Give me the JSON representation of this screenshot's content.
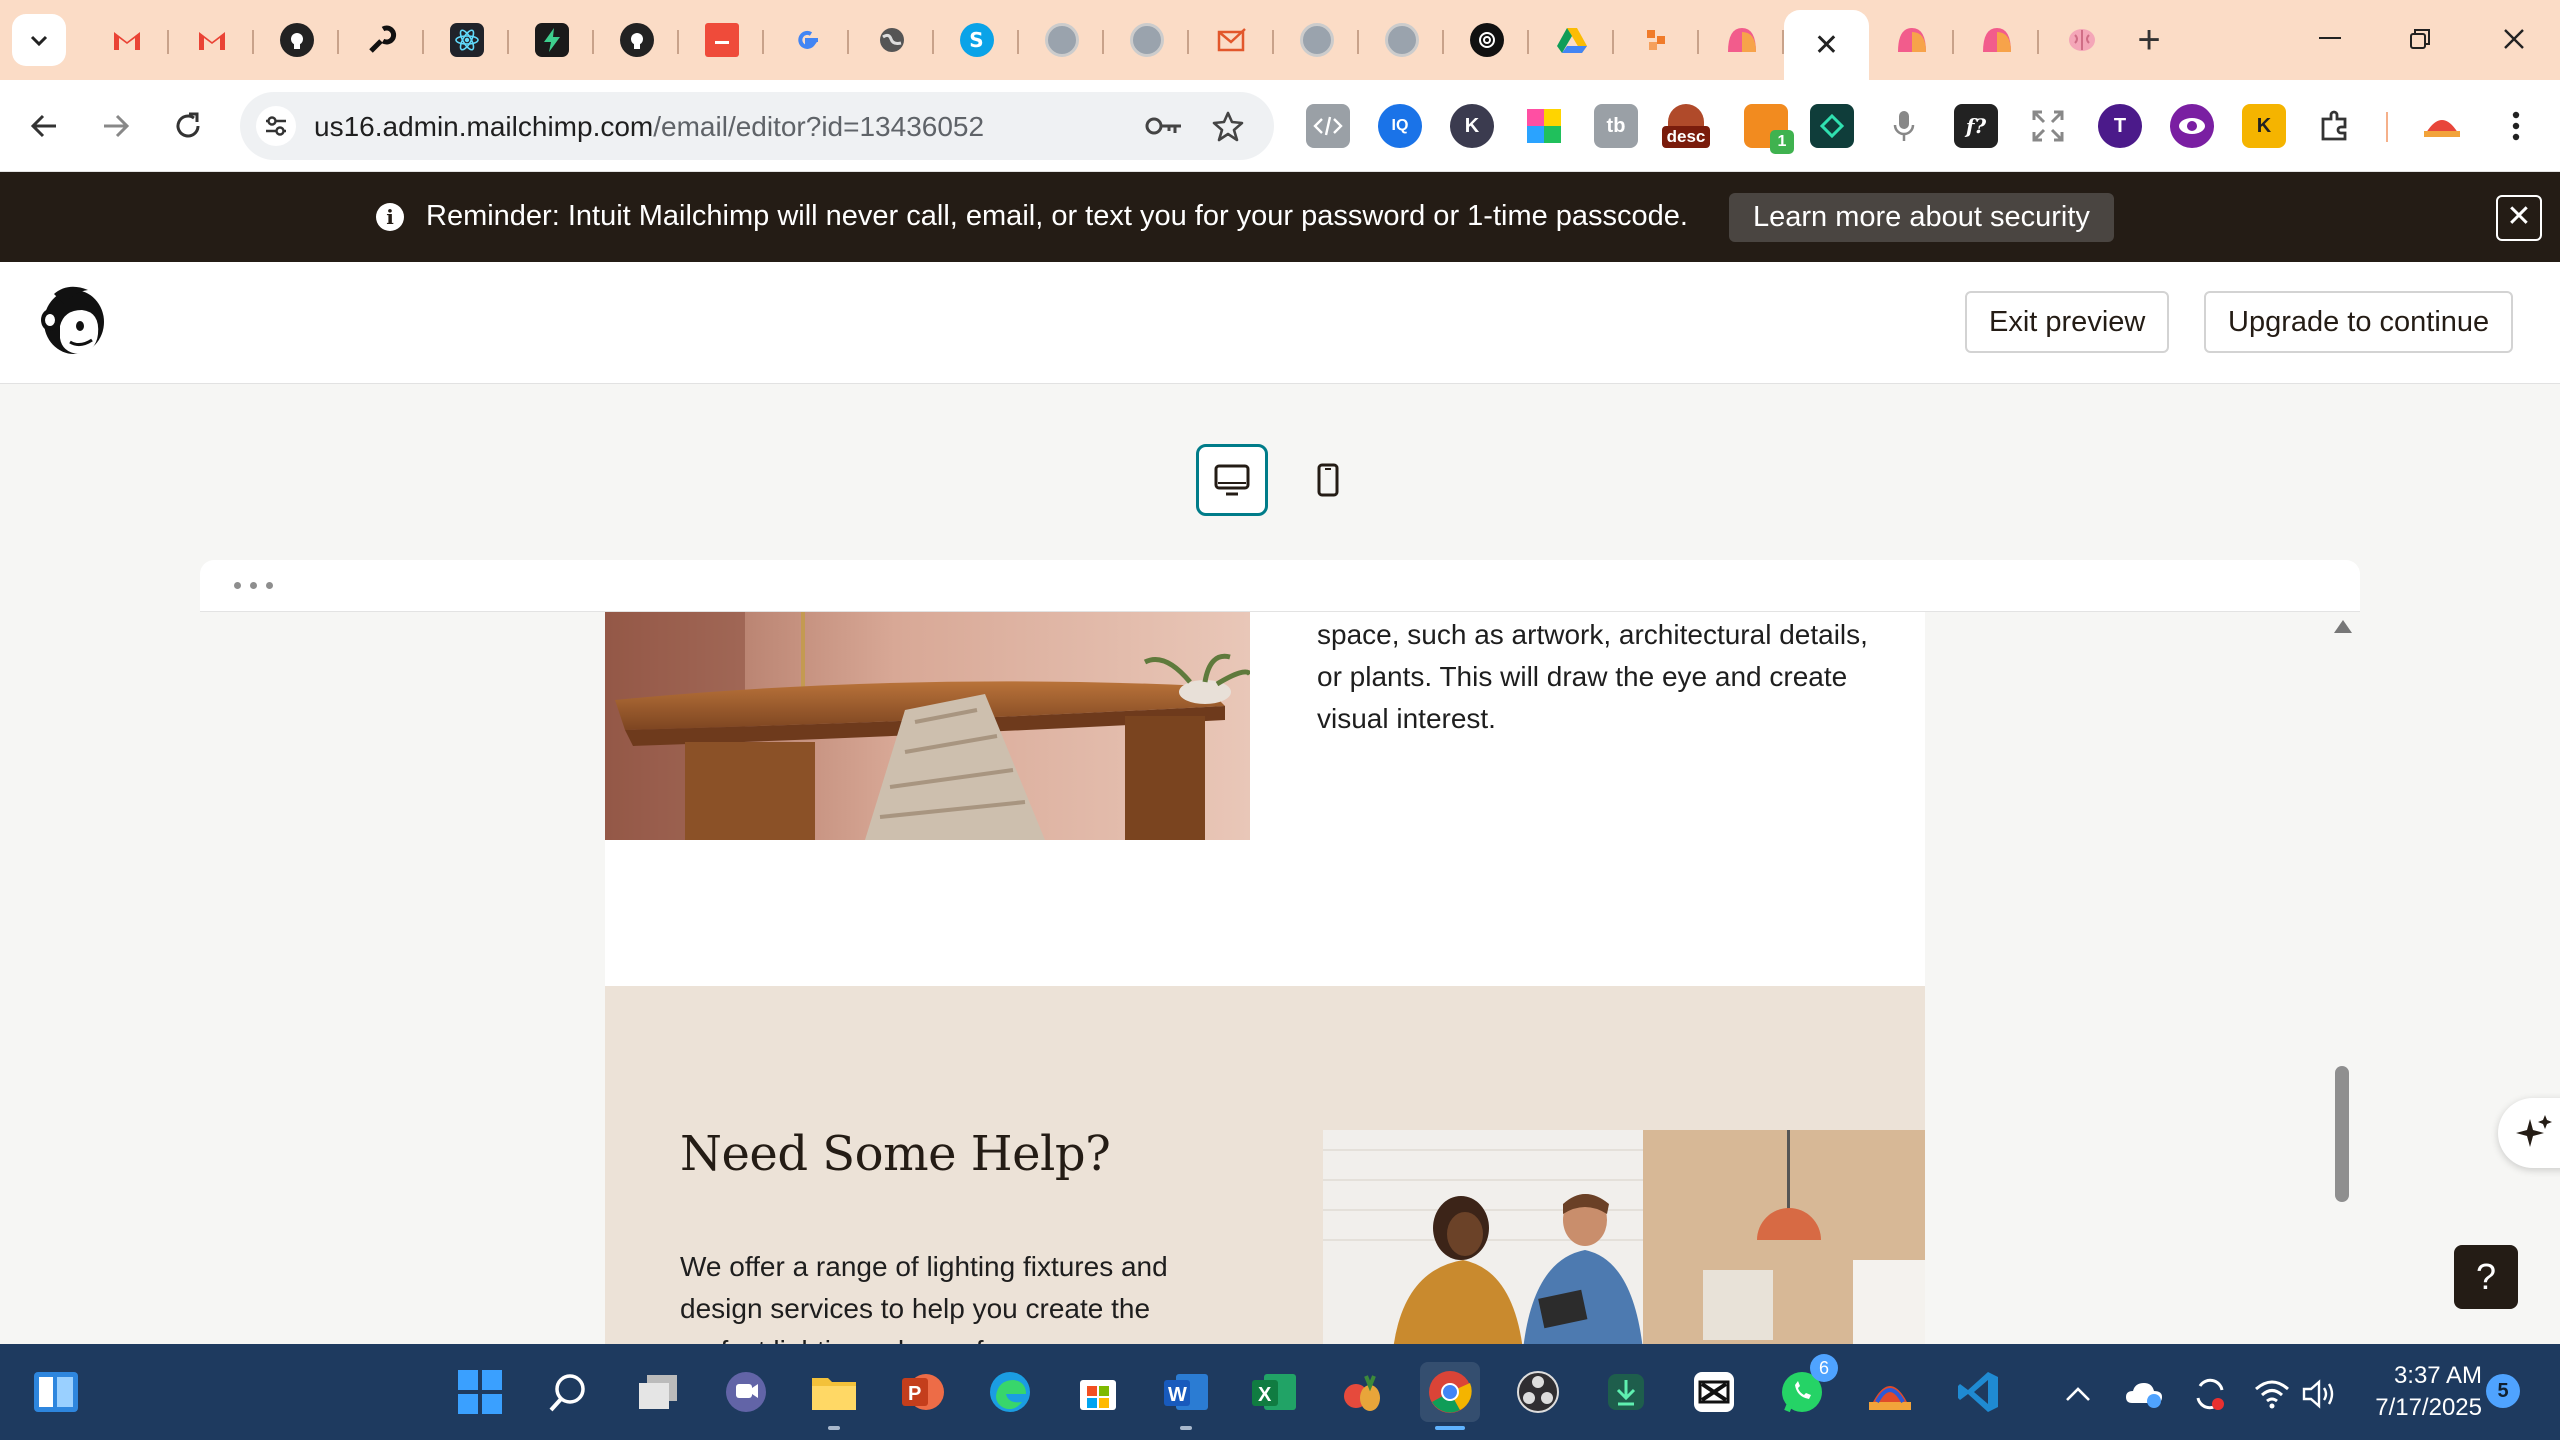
{
  "browser": {
    "url_domain": "us16.admin.mailchimp.com",
    "url_path": "/email/editor?id=13436052",
    "active_tab_close": "✕",
    "new_tab": "+"
  },
  "extensions": {
    "desc_label": "desc",
    "badge_count": "1"
  },
  "banner": {
    "info_glyph": "i",
    "message": "Reminder: Intuit Mailchimp will never call, email, or text you for your password or 1-time passcode.",
    "learn_more": "Learn more about security",
    "close_glyph": "✕"
  },
  "header": {
    "exit_preview": "Exit preview",
    "upgrade": "Upgrade to continue"
  },
  "email": {
    "intro_partial": "Consider highlighting key features in your space, such as artwork, architectural details, or plants. This will draw the eye and create visual interest.",
    "help_title": "Need Some Help?",
    "help_body": "We offer a range of lighting fixtures and design services to help you create the perfect lighting scheme for your space."
  },
  "widgets": {
    "help_glyph": "?"
  },
  "taskbar": {
    "whatsapp_badge": "6",
    "time": "3:37 AM",
    "date": "7/17/2025",
    "notifications": "5"
  },
  "colors": {
    "tabstrip": "#fbdcc6",
    "mailchimp_dark": "#241c15",
    "accent_teal": "#007c89",
    "help_section_bg": "#ece2d7",
    "taskbar": "#1e3a5f"
  }
}
